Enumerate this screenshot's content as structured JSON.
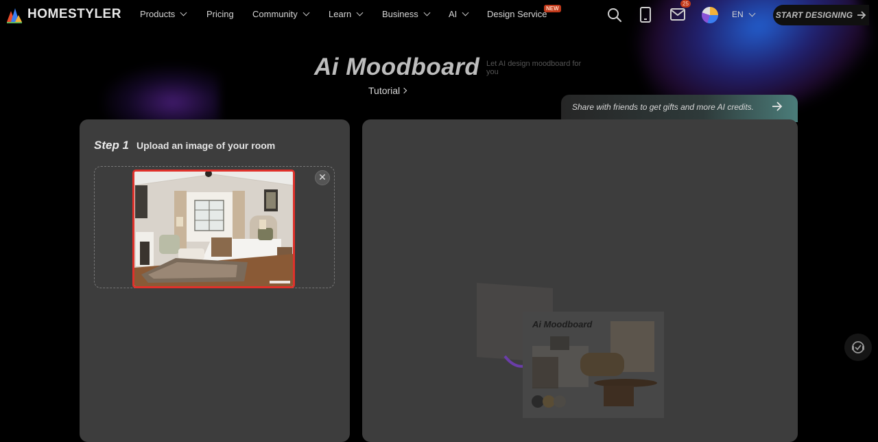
{
  "brand": {
    "name": "HOMESTYLER"
  },
  "nav": {
    "items": [
      {
        "label": "Products",
        "has_dropdown": true
      },
      {
        "label": "Pricing",
        "has_dropdown": false
      },
      {
        "label": "Community",
        "has_dropdown": true
      },
      {
        "label": "Learn",
        "has_dropdown": true
      },
      {
        "label": "Business",
        "has_dropdown": true
      },
      {
        "label": "AI",
        "has_dropdown": true
      },
      {
        "label": "Design Service",
        "has_dropdown": false
      }
    ],
    "new_badge": "NEW",
    "mail_count": "25",
    "language": "EN",
    "start_button": "START DESIGNING"
  },
  "hero": {
    "title": "Ai Moodboard",
    "subtitle": "Let AI design moodboard for you",
    "tutorial_link": "Tutorial"
  },
  "share_banner": {
    "text": "Share with friends to get gifts and more AI credits."
  },
  "step1": {
    "label": "Step 1",
    "description": "Upload an image of your room"
  },
  "preview": {
    "title": "Ai Moodboard"
  },
  "colors": {
    "background": "#000000",
    "panel": "#3d3d3d",
    "highlight_border": "#e0312b",
    "badge": "#c0391b"
  },
  "icons": [
    "search-icon",
    "mobile-icon",
    "mail-icon",
    "globe-icon",
    "arrow-right-icon",
    "close-icon",
    "chevron-down-icon",
    "support-icon"
  ]
}
